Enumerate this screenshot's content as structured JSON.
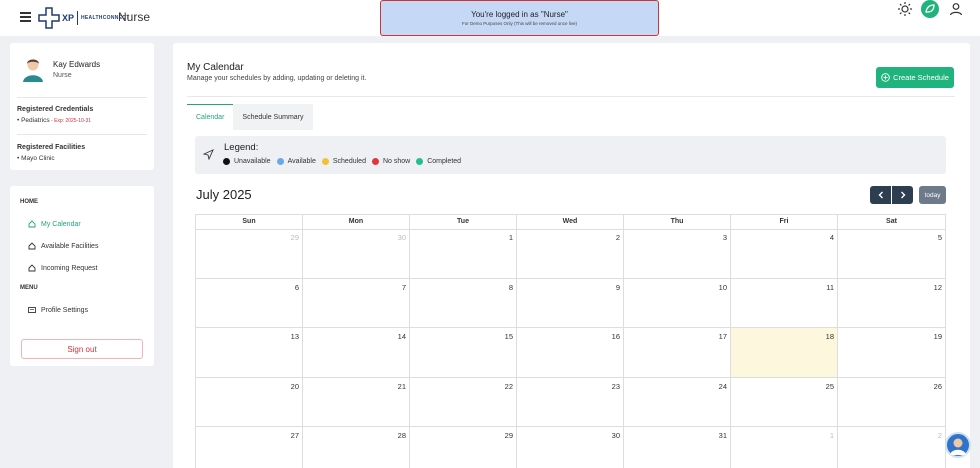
{
  "app": {
    "logo_xp": "XP",
    "logo_text": "HEALTHCONNECT",
    "role_title": "Nurse"
  },
  "banner": {
    "title": "You're logged in as \"Nurse\"",
    "subtitle": "For Demo Purposes Only (This will be removed once live)"
  },
  "profile": {
    "name": "Kay Edwards",
    "role": "Nurse",
    "credentials_title": "Registered Credentials",
    "credential": "• Pediatrics",
    "credential_exp": " - Exp: 2025-10-31",
    "facilities_title": "Registered Facilities",
    "facility": "• Mayo Clinic"
  },
  "nav": {
    "home_head": "HOME",
    "my_calendar": "My Calendar",
    "available_facilities": "Available Facilities",
    "incoming_request": "Incoming Request",
    "menu_head": "MENU",
    "profile_settings": "Profile Settings",
    "sign_out": "Sign out"
  },
  "main": {
    "title": "My Calendar",
    "subtitle": "Manage your schedules by adding, updating or deleting it.",
    "create_label": "Create Schedule",
    "tabs": [
      {
        "label": "Calendar",
        "active": true
      },
      {
        "label": "Schedule Summary",
        "active": false
      }
    ]
  },
  "legend": {
    "title": "Legend:",
    "items": [
      {
        "label": "Unavailable",
        "color": "#111111"
      },
      {
        "label": "Available",
        "color": "#6aa8e8"
      },
      {
        "label": "Scheduled",
        "color": "#f2c232"
      },
      {
        "label": "No show",
        "color": "#e0363c"
      },
      {
        "label": "Completed",
        "color": "#20c08a"
      }
    ]
  },
  "calendar": {
    "month_label": "July 2025",
    "today_label": "today",
    "weekdays": [
      "Sun",
      "Mon",
      "Tue",
      "Wed",
      "Thu",
      "Fri",
      "Sat"
    ],
    "days": [
      {
        "d": "29",
        "other": true
      },
      {
        "d": "30",
        "other": true
      },
      {
        "d": "1"
      },
      {
        "d": "2"
      },
      {
        "d": "3"
      },
      {
        "d": "4"
      },
      {
        "d": "5"
      },
      {
        "d": "6"
      },
      {
        "d": "7"
      },
      {
        "d": "8"
      },
      {
        "d": "9"
      },
      {
        "d": "10"
      },
      {
        "d": "11"
      },
      {
        "d": "12"
      },
      {
        "d": "13"
      },
      {
        "d": "14"
      },
      {
        "d": "15"
      },
      {
        "d": "16"
      },
      {
        "d": "17"
      },
      {
        "d": "18",
        "today": true
      },
      {
        "d": "19"
      },
      {
        "d": "20"
      },
      {
        "d": "21"
      },
      {
        "d": "22"
      },
      {
        "d": "23"
      },
      {
        "d": "24"
      },
      {
        "d": "25"
      },
      {
        "d": "26"
      },
      {
        "d": "27"
      },
      {
        "d": "28"
      },
      {
        "d": "29"
      },
      {
        "d": "30"
      },
      {
        "d": "31"
      },
      {
        "d": "1",
        "other": true
      },
      {
        "d": "2",
        "other": true
      }
    ]
  },
  "colors": {
    "accent": "#20b37e",
    "danger": "#d0323b",
    "today_bg": "#fcf7dd",
    "nav_dark": "#2c3e50"
  }
}
